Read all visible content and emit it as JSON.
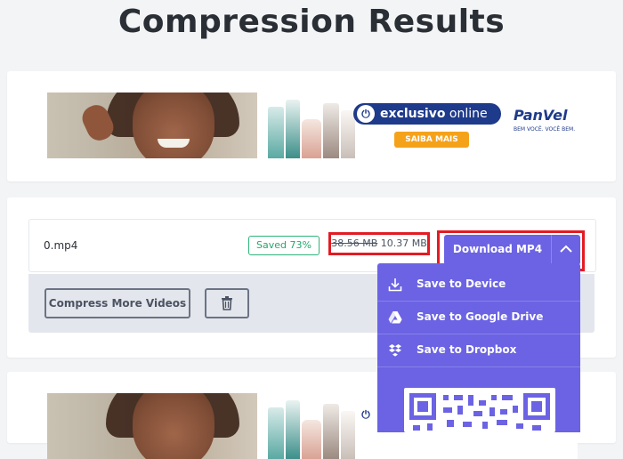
{
  "page": {
    "title": "Compression Results"
  },
  "ad": {
    "badge_bold": "exclusivo",
    "badge_light": " online",
    "power_symbol": "⏻",
    "cta": "SAIBA MAIS",
    "brand": "PanVel",
    "tagline": "BEM VOCÊ. VOCÊ BEM."
  },
  "result": {
    "filename": "0.mp4",
    "saved_badge": "Saved 73%",
    "original_size": "38.56 MB",
    "new_size": "10.37 MB",
    "download_label": "Download MP4"
  },
  "actions": {
    "compress_more": "Compress More Videos"
  },
  "dropdown": {
    "items": [
      {
        "label": "Save to Device",
        "icon": "download-icon"
      },
      {
        "label": "Save to Google Drive",
        "icon": "google-drive-icon"
      },
      {
        "label": "Save to Dropbox",
        "icon": "dropbox-icon"
      }
    ]
  },
  "colors": {
    "accent": "#6b63e3",
    "highlight_border": "#e31b23",
    "saved_green": "#23a86e"
  }
}
